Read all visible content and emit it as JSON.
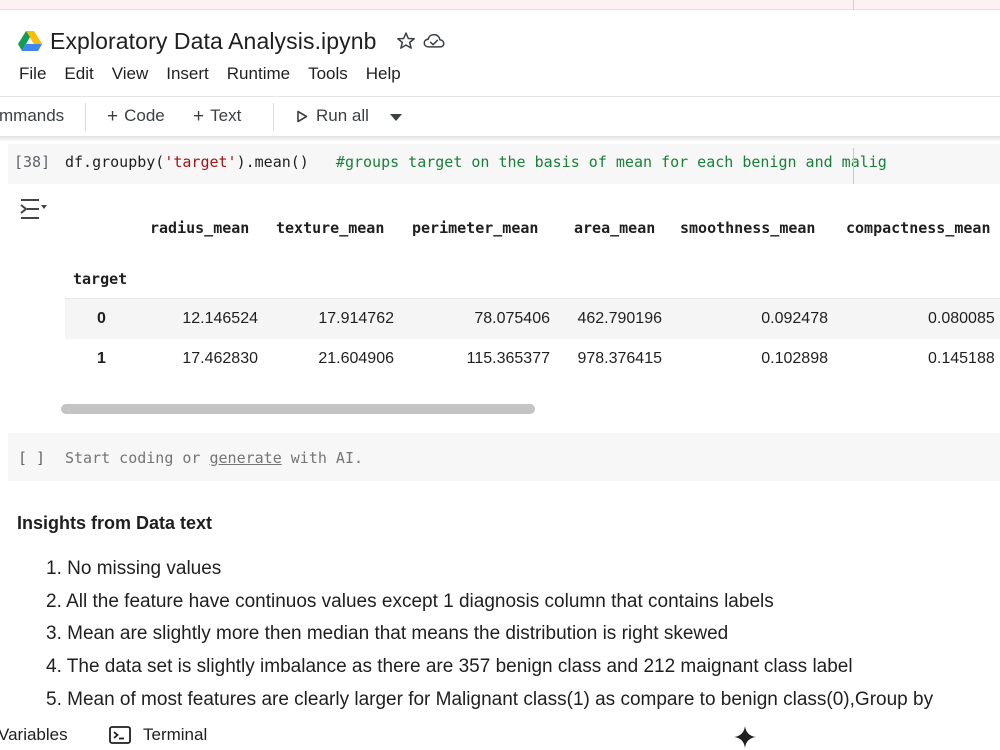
{
  "notebook": {
    "title": "Exploratory Data Analysis.ipynb",
    "star_icon": "star-icon",
    "cloud_icon": "cloud-saved-icon",
    "drive_icon": "google-drive-icon"
  },
  "menu": [
    "File",
    "Edit",
    "View",
    "Insert",
    "Runtime",
    "Tools",
    "Help"
  ],
  "toolbar": {
    "commands_label": "mmands",
    "code_label": "Code",
    "text_label": "Text",
    "run_all_label": "Run all",
    "plus_glyph": "+"
  },
  "code_cell": {
    "exec_count": "[38]",
    "code_prefix": "df.groupby(",
    "code_string": "'target'",
    "code_suffix": ").mean()",
    "comment": "   #groups target on the basis of mean for each benign and malig"
  },
  "output_table": {
    "index_name": "target",
    "columns": [
      "radius_mean",
      "texture_mean",
      "perimeter_mean",
      "area_mean",
      "smoothness_mean",
      "compactness_mean"
    ],
    "rows": [
      {
        "index": "0",
        "values": [
          "12.146524",
          "17.914762",
          "78.075406",
          "462.790196",
          "0.092478",
          "0.080085"
        ]
      },
      {
        "index": "1",
        "values": [
          "17.462830",
          "21.604906",
          "115.365377",
          "978.376415",
          "0.102898",
          "0.145188"
        ]
      }
    ]
  },
  "empty_cell": {
    "bracket": "[ ]",
    "placeholder_start": "Start coding or ",
    "placeholder_link": "generate",
    "placeholder_end": " with AI."
  },
  "text_cell": {
    "heading": "Insights from Data text",
    "items": [
      "1. No missing values",
      "2. All the feature have continuos values except 1 diagnosis column that contains labels",
      "3. Mean are slightly more then median that means the distribution is right skewed",
      "4. The data set is slightly imbalance as there are 357 benign class and 212 maignant class label",
      "5. Mean of most features are clearly larger for Malignant class(1) as compare to benign class(0),Group by"
    ]
  },
  "bottom_bar": {
    "variables_label": "Variables",
    "terminal_label": "Terminal",
    "gemini_icon": "gemini-sparkle-icon"
  },
  "colors": {
    "accent": "#1a73e8",
    "string": "#a31515",
    "comment": "#188038",
    "cell_bg": "#f7f7f7"
  }
}
